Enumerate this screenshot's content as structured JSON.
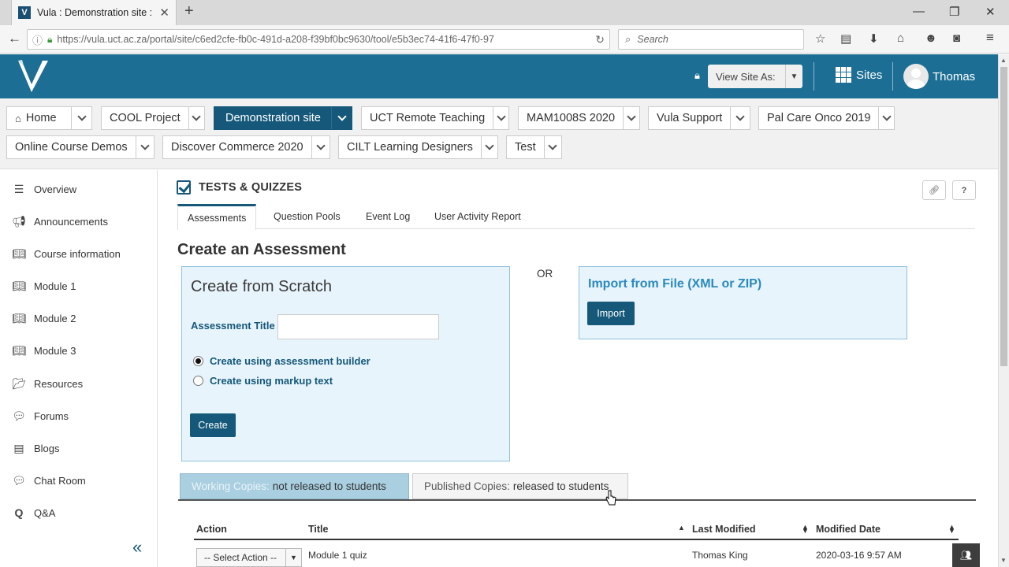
{
  "browser": {
    "tab_title": "Vula : Demonstration site :...",
    "tab_favicon": "V",
    "url": "https://vula.uct.ac.za/portal/site/c6ed2cfe-fb0c-491d-a208-f39bf0bc9630/tool/e5b3ec74-41f6-47f0-97",
    "search_placeholder": "Search"
  },
  "header": {
    "view_site_as": "View Site As:",
    "sites_label": "Sites",
    "user_name": "Thomas"
  },
  "site_nav": {
    "items": [
      {
        "label": "Home"
      },
      {
        "label": "COOL Project"
      },
      {
        "label": "Demonstration site"
      },
      {
        "label": "UCT Remote Teaching"
      },
      {
        "label": "MAM1008S 2020"
      },
      {
        "label": "Vula Support"
      },
      {
        "label": "Pal Care Onco 2019"
      },
      {
        "label": "Online Course Demos"
      },
      {
        "label": "Discover Commerce 2020"
      },
      {
        "label": "CILT Learning Designers"
      },
      {
        "label": "Test"
      }
    ]
  },
  "tool_menu": {
    "items": [
      {
        "label": "Overview",
        "icon": "list-icon"
      },
      {
        "label": "Announcements",
        "icon": "megaphone-icon"
      },
      {
        "label": "Course information",
        "icon": "book-icon"
      },
      {
        "label": "Module 1",
        "icon": "book-icon"
      },
      {
        "label": "Module 2",
        "icon": "book-icon"
      },
      {
        "label": "Module 3",
        "icon": "book-icon"
      },
      {
        "label": "Resources",
        "icon": "folder-icon"
      },
      {
        "label": "Forums",
        "icon": "comments-icon"
      },
      {
        "label": "Blogs",
        "icon": "blog-icon"
      },
      {
        "label": "Chat Room",
        "icon": "chat-icon"
      },
      {
        "label": "Q&A",
        "icon": "qa-icon"
      }
    ]
  },
  "tool": {
    "title": "TESTS & QUIZZES",
    "tabs": [
      {
        "label": "Assessments"
      },
      {
        "label": "Question Pools"
      },
      {
        "label": "Event Log"
      },
      {
        "label": "User Activity Report"
      }
    ],
    "create_heading": "Create an Assessment",
    "scratch": {
      "title": "Create from Scratch",
      "field_label": "Assessment Title",
      "field_value": "",
      "option_builder": "Create using assessment builder",
      "option_markup": "Create using markup text",
      "create_button": "Create"
    },
    "or_label": "OR",
    "import": {
      "title": "Import from File (XML or ZIP)",
      "button": "Import"
    },
    "copies": {
      "working_prefix": "Working Copies:",
      "working_suffix": "not released to students",
      "published_prefix": "Published Copies:",
      "published_suffix": "released to students"
    },
    "table": {
      "headers": {
        "action": "Action",
        "title": "Title",
        "last_modified": "Last Modified",
        "modified_date": "Modified Date"
      },
      "rows": [
        {
          "action": "-- Select Action --",
          "title": "Module 1 quiz",
          "last_modified": "Thomas King",
          "modified_date": "2020-03-16 9:57 AM"
        }
      ]
    }
  },
  "colors": {
    "header_blue": "#1c6e94",
    "active_navy": "#15587a",
    "panel_bg": "#e8f4fb",
    "link_blue": "#2a8ac0"
  }
}
